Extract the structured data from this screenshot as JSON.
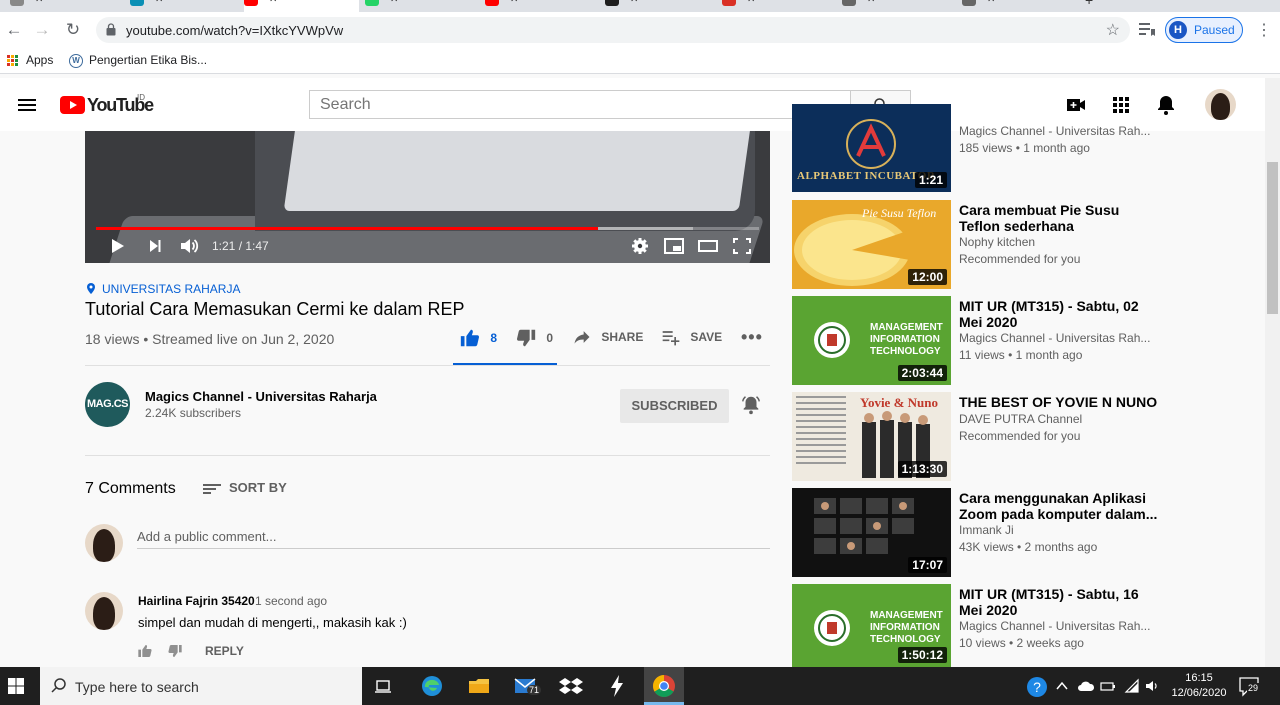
{
  "browser": {
    "url": "youtube.com/watch?v=IXtkcYVWpVw",
    "profile_initial": "H",
    "profile_status": "Paused",
    "bookmarks": [
      {
        "label": "Apps"
      },
      {
        "label": "Pengertian Etika Bis..."
      }
    ]
  },
  "youtube": {
    "logo_text": "YouTube",
    "region": "ID",
    "search_placeholder": "Search"
  },
  "player": {
    "current_time": "1:21",
    "duration": "1:47",
    "time_display": "1:21 / 1:47",
    "progress_fraction": 0.7565,
    "buffered_fraction": 0.9
  },
  "video": {
    "location": "UNIVERSITAS RAHARJA",
    "title": "Tutorial Cara Memasukan Cermi ke dalam REP",
    "stats": "18 views • Streamed live on Jun 2, 2020",
    "likes": "8",
    "dislikes": "0",
    "share_label": "SHARE",
    "save_label": "SAVE"
  },
  "channel": {
    "avatar_text": "MAG.CS",
    "name": "Magics Channel - Universitas Raharja",
    "subscribers": "2.24K subscribers",
    "subscribe_label": "SUBSCRIBED"
  },
  "comments": {
    "count_label": "7 Comments",
    "sort_label": "SORT BY",
    "add_placeholder": "Add a public comment...",
    "items": [
      {
        "author": "Hairlina Fajrin 35420",
        "time": "1 second ago",
        "text": "simpel dan mudah di mengerti,, makasih kak :)",
        "reply_label": "REPLY"
      }
    ]
  },
  "sidebar": [
    {
      "thumb_text": "ALPHABET INCUBATOR",
      "duration": "1:21",
      "title": "",
      "channel": "Magics Channel - Universitas Rah...",
      "meta": "185 views • 1 month ago"
    },
    {
      "thumb_text": "Pie Susu Teflon",
      "duration": "12:00",
      "title": "Cara membuat Pie Susu Teflon sederhana",
      "channel": "Nophy kitchen",
      "meta": "Recommended for you"
    },
    {
      "thumb_text": "MANAGEMENT INFORMATION TECHNOLOGY",
      "duration": "2:03:44",
      "title": "MIT UR (MT315) - Sabtu, 02 Mei 2020",
      "channel": "Magics Channel - Universitas Rah...",
      "meta": "11 views • 1 month ago"
    },
    {
      "thumb_text": "Yovie & Nuno",
      "duration": "1:13:30",
      "title": "THE BEST OF YOVIE N NUNO",
      "channel": "DAVE PUTRA Channel",
      "meta": "Recommended for you"
    },
    {
      "thumb_text": "",
      "duration": "17:07",
      "title": "Cara menggunakan Aplikasi Zoom pada komputer dalam...",
      "channel": "Immank Ji",
      "meta": "43K views • 2 months ago"
    },
    {
      "thumb_text": "MANAGEMENT INFORMATION TECHNOLOGY",
      "duration": "1:50:12",
      "title": "MIT UR (MT315) - Sabtu, 16 Mei 2020",
      "channel": "Magics Channel - Universitas Rah...",
      "meta": "10 views • 2 weeks ago"
    }
  ],
  "taskbar": {
    "search_placeholder": "Type here to search",
    "mail_badge": "71",
    "time": "16:15",
    "date": "12/06/2020",
    "notification_count": "29"
  },
  "colors": {
    "yt_red": "#ff0000",
    "link_blue": "#065fd4",
    "chrome_blue": "#1a73e8"
  }
}
